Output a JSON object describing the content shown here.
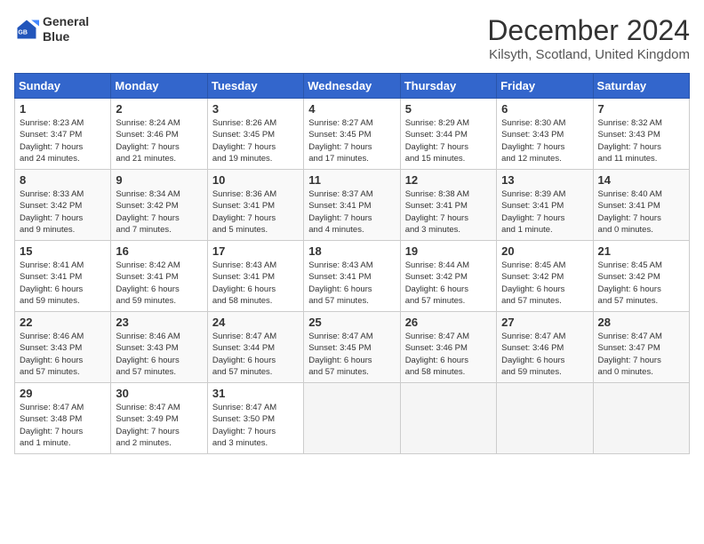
{
  "logo": {
    "line1": "General",
    "line2": "Blue"
  },
  "title": "December 2024",
  "subtitle": "Kilsyth, Scotland, United Kingdom",
  "headers": [
    "Sunday",
    "Monday",
    "Tuesday",
    "Wednesday",
    "Thursday",
    "Friday",
    "Saturday"
  ],
  "weeks": [
    [
      {
        "day": "1",
        "info": "Sunrise: 8:23 AM\nSunset: 3:47 PM\nDaylight: 7 hours\nand 24 minutes."
      },
      {
        "day": "2",
        "info": "Sunrise: 8:24 AM\nSunset: 3:46 PM\nDaylight: 7 hours\nand 21 minutes."
      },
      {
        "day": "3",
        "info": "Sunrise: 8:26 AM\nSunset: 3:45 PM\nDaylight: 7 hours\nand 19 minutes."
      },
      {
        "day": "4",
        "info": "Sunrise: 8:27 AM\nSunset: 3:45 PM\nDaylight: 7 hours\nand 17 minutes."
      },
      {
        "day": "5",
        "info": "Sunrise: 8:29 AM\nSunset: 3:44 PM\nDaylight: 7 hours\nand 15 minutes."
      },
      {
        "day": "6",
        "info": "Sunrise: 8:30 AM\nSunset: 3:43 PM\nDaylight: 7 hours\nand 12 minutes."
      },
      {
        "day": "7",
        "info": "Sunrise: 8:32 AM\nSunset: 3:43 PM\nDaylight: 7 hours\nand 11 minutes."
      }
    ],
    [
      {
        "day": "8",
        "info": "Sunrise: 8:33 AM\nSunset: 3:42 PM\nDaylight: 7 hours\nand 9 minutes."
      },
      {
        "day": "9",
        "info": "Sunrise: 8:34 AM\nSunset: 3:42 PM\nDaylight: 7 hours\nand 7 minutes."
      },
      {
        "day": "10",
        "info": "Sunrise: 8:36 AM\nSunset: 3:41 PM\nDaylight: 7 hours\nand 5 minutes."
      },
      {
        "day": "11",
        "info": "Sunrise: 8:37 AM\nSunset: 3:41 PM\nDaylight: 7 hours\nand 4 minutes."
      },
      {
        "day": "12",
        "info": "Sunrise: 8:38 AM\nSunset: 3:41 PM\nDaylight: 7 hours\nand 3 minutes."
      },
      {
        "day": "13",
        "info": "Sunrise: 8:39 AM\nSunset: 3:41 PM\nDaylight: 7 hours\nand 1 minute."
      },
      {
        "day": "14",
        "info": "Sunrise: 8:40 AM\nSunset: 3:41 PM\nDaylight: 7 hours\nand 0 minutes."
      }
    ],
    [
      {
        "day": "15",
        "info": "Sunrise: 8:41 AM\nSunset: 3:41 PM\nDaylight: 6 hours\nand 59 minutes."
      },
      {
        "day": "16",
        "info": "Sunrise: 8:42 AM\nSunset: 3:41 PM\nDaylight: 6 hours\nand 59 minutes."
      },
      {
        "day": "17",
        "info": "Sunrise: 8:43 AM\nSunset: 3:41 PM\nDaylight: 6 hours\nand 58 minutes."
      },
      {
        "day": "18",
        "info": "Sunrise: 8:43 AM\nSunset: 3:41 PM\nDaylight: 6 hours\nand 57 minutes."
      },
      {
        "day": "19",
        "info": "Sunrise: 8:44 AM\nSunset: 3:42 PM\nDaylight: 6 hours\nand 57 minutes."
      },
      {
        "day": "20",
        "info": "Sunrise: 8:45 AM\nSunset: 3:42 PM\nDaylight: 6 hours\nand 57 minutes."
      },
      {
        "day": "21",
        "info": "Sunrise: 8:45 AM\nSunset: 3:42 PM\nDaylight: 6 hours\nand 57 minutes."
      }
    ],
    [
      {
        "day": "22",
        "info": "Sunrise: 8:46 AM\nSunset: 3:43 PM\nDaylight: 6 hours\nand 57 minutes."
      },
      {
        "day": "23",
        "info": "Sunrise: 8:46 AM\nSunset: 3:43 PM\nDaylight: 6 hours\nand 57 minutes."
      },
      {
        "day": "24",
        "info": "Sunrise: 8:47 AM\nSunset: 3:44 PM\nDaylight: 6 hours\nand 57 minutes."
      },
      {
        "day": "25",
        "info": "Sunrise: 8:47 AM\nSunset: 3:45 PM\nDaylight: 6 hours\nand 57 minutes."
      },
      {
        "day": "26",
        "info": "Sunrise: 8:47 AM\nSunset: 3:46 PM\nDaylight: 6 hours\nand 58 minutes."
      },
      {
        "day": "27",
        "info": "Sunrise: 8:47 AM\nSunset: 3:46 PM\nDaylight: 6 hours\nand 59 minutes."
      },
      {
        "day": "28",
        "info": "Sunrise: 8:47 AM\nSunset: 3:47 PM\nDaylight: 7 hours\nand 0 minutes."
      }
    ],
    [
      {
        "day": "29",
        "info": "Sunrise: 8:47 AM\nSunset: 3:48 PM\nDaylight: 7 hours\nand 1 minute."
      },
      {
        "day": "30",
        "info": "Sunrise: 8:47 AM\nSunset: 3:49 PM\nDaylight: 7 hours\nand 2 minutes."
      },
      {
        "day": "31",
        "info": "Sunrise: 8:47 AM\nSunset: 3:50 PM\nDaylight: 7 hours\nand 3 minutes."
      },
      {
        "day": "",
        "info": ""
      },
      {
        "day": "",
        "info": ""
      },
      {
        "day": "",
        "info": ""
      },
      {
        "day": "",
        "info": ""
      }
    ]
  ]
}
